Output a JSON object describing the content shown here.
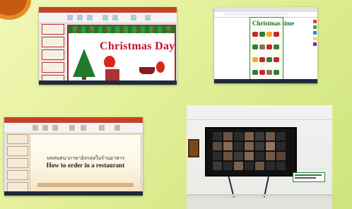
{
  "screenshots": {
    "ppt_christmas": {
      "slide_title": "Christmas Day"
    },
    "browser_worksheet": {
      "sheet_title": "Christmas time"
    },
    "ppt_restaurant": {
      "slide_subtitle_thai": "บทสนทนาภาษาอังกฤษในร้านอาหาร",
      "slide_title": "How to order in a restaurant"
    },
    "video_call_photo": {}
  }
}
